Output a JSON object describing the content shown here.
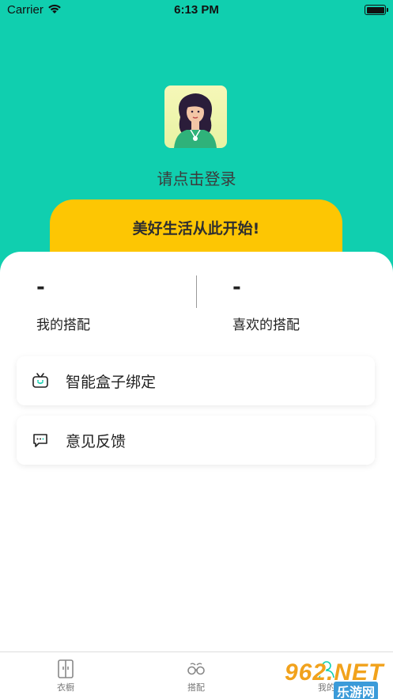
{
  "status_bar": {
    "carrier": "Carrier",
    "time": "6:13 PM"
  },
  "header": {
    "login_text": "请点击登录",
    "banner_text": "美好生活从此开始!"
  },
  "stats": [
    {
      "value": "-",
      "label": "我的搭配"
    },
    {
      "value": "-",
      "label": "喜欢的搭配"
    }
  ],
  "menu": [
    {
      "label": "智能盒子绑定",
      "icon": "tv-box-icon"
    },
    {
      "label": "意见反馈",
      "icon": "message-icon"
    }
  ],
  "tabs": [
    {
      "label": "衣橱",
      "icon": "wardrobe-icon"
    },
    {
      "label": "搭配",
      "icon": "glasses-icon"
    },
    {
      "label": "我的",
      "icon": "profile-icon"
    }
  ],
  "watermark": {
    "text": "962.NET",
    "sub": "乐游网"
  },
  "colors": {
    "background": "#10cfaf",
    "banner": "#fdc603",
    "card": "#ffffff"
  }
}
